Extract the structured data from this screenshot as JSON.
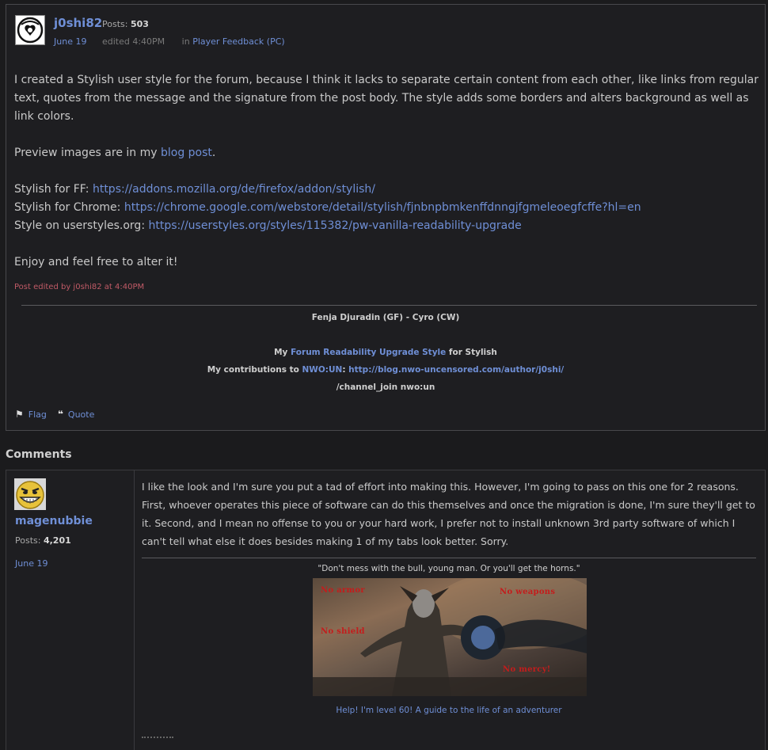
{
  "post": {
    "author": "j0shi82",
    "posts_label": "Posts:",
    "posts_count": "503",
    "date": "June 19",
    "edited": "edited 4:40PM",
    "in_label": "in",
    "category": "Player Feedback (PC)",
    "paragraph1": "I created a Stylish user style for the forum, because I think it lacks to separate certain content from each other, like links from regular text, quotes from the message and the signature from the post body. The style adds some borders and alters background as well as link colors.",
    "preview_prefix": "Preview images are in my ",
    "preview_link": "blog post",
    "preview_suffix": ".",
    "ff_label": "Stylish for FF: ",
    "ff_url": "https://addons.mozilla.org/de/firefox/addon/stylish/",
    "chrome_label": "Stylish for Chrome: ",
    "chrome_url": "https://chrome.google.com/webstore/detail/stylish/fjnbnpbmkenffdnngjfgmeleoegfcffe?hl=en",
    "us_label": "Style on userstyles.org: ",
    "us_url": "https://userstyles.org/styles/115382/pw-vanilla-readability-upgrade",
    "closing": "Enjoy and feel free to alter it!",
    "edit_note": "Post edited by j0shi82 at 4:40PM",
    "signature": {
      "line1": "Fenja Djuradin (GF) - Cyro (CW)",
      "line2_prefix": "My ",
      "line2_link": "Forum Readability Upgrade Style",
      "line2_suffix": " for Stylish",
      "line3_prefix": "My contributions to ",
      "line3_link1": "NWO:UN",
      "line3_colon": ": ",
      "line3_link2": "http://blog.nwo-uncensored.com/author/j0shi/",
      "line4": "/channel_join nwo:un"
    },
    "actions": {
      "flag": "Flag",
      "quote": "Quote"
    }
  },
  "comments": {
    "heading": "Comments",
    "items": [
      {
        "author": "magenubbie",
        "posts_label": "Posts:",
        "posts_count": "4,201",
        "date": "June 19",
        "body": "I like the look and I'm sure you put a tad of effort into making this. However, I'm going to pass on this one for 2 reasons. First, whoever operates this piece of software can do this themselves and once the migration is done, I'm sure they'll get to it. Second, and I mean no offense to you or your hard work, I prefer not to install unknown 3rd party software of which I can't tell what else it does besides making 1 of my tabs look better. Sorry.",
        "sig_quote": "\"Don't mess with the bull, young man. Or you'll get the horns.\"",
        "banner": {
          "no_armor": "No armor",
          "no_weapons": "No weapons",
          "no_shield": "No shield",
          "no_mercy": "No mercy!"
        },
        "sig_link": "Help! I'm level 60! A guide to the life of an adventurer"
      }
    ]
  }
}
